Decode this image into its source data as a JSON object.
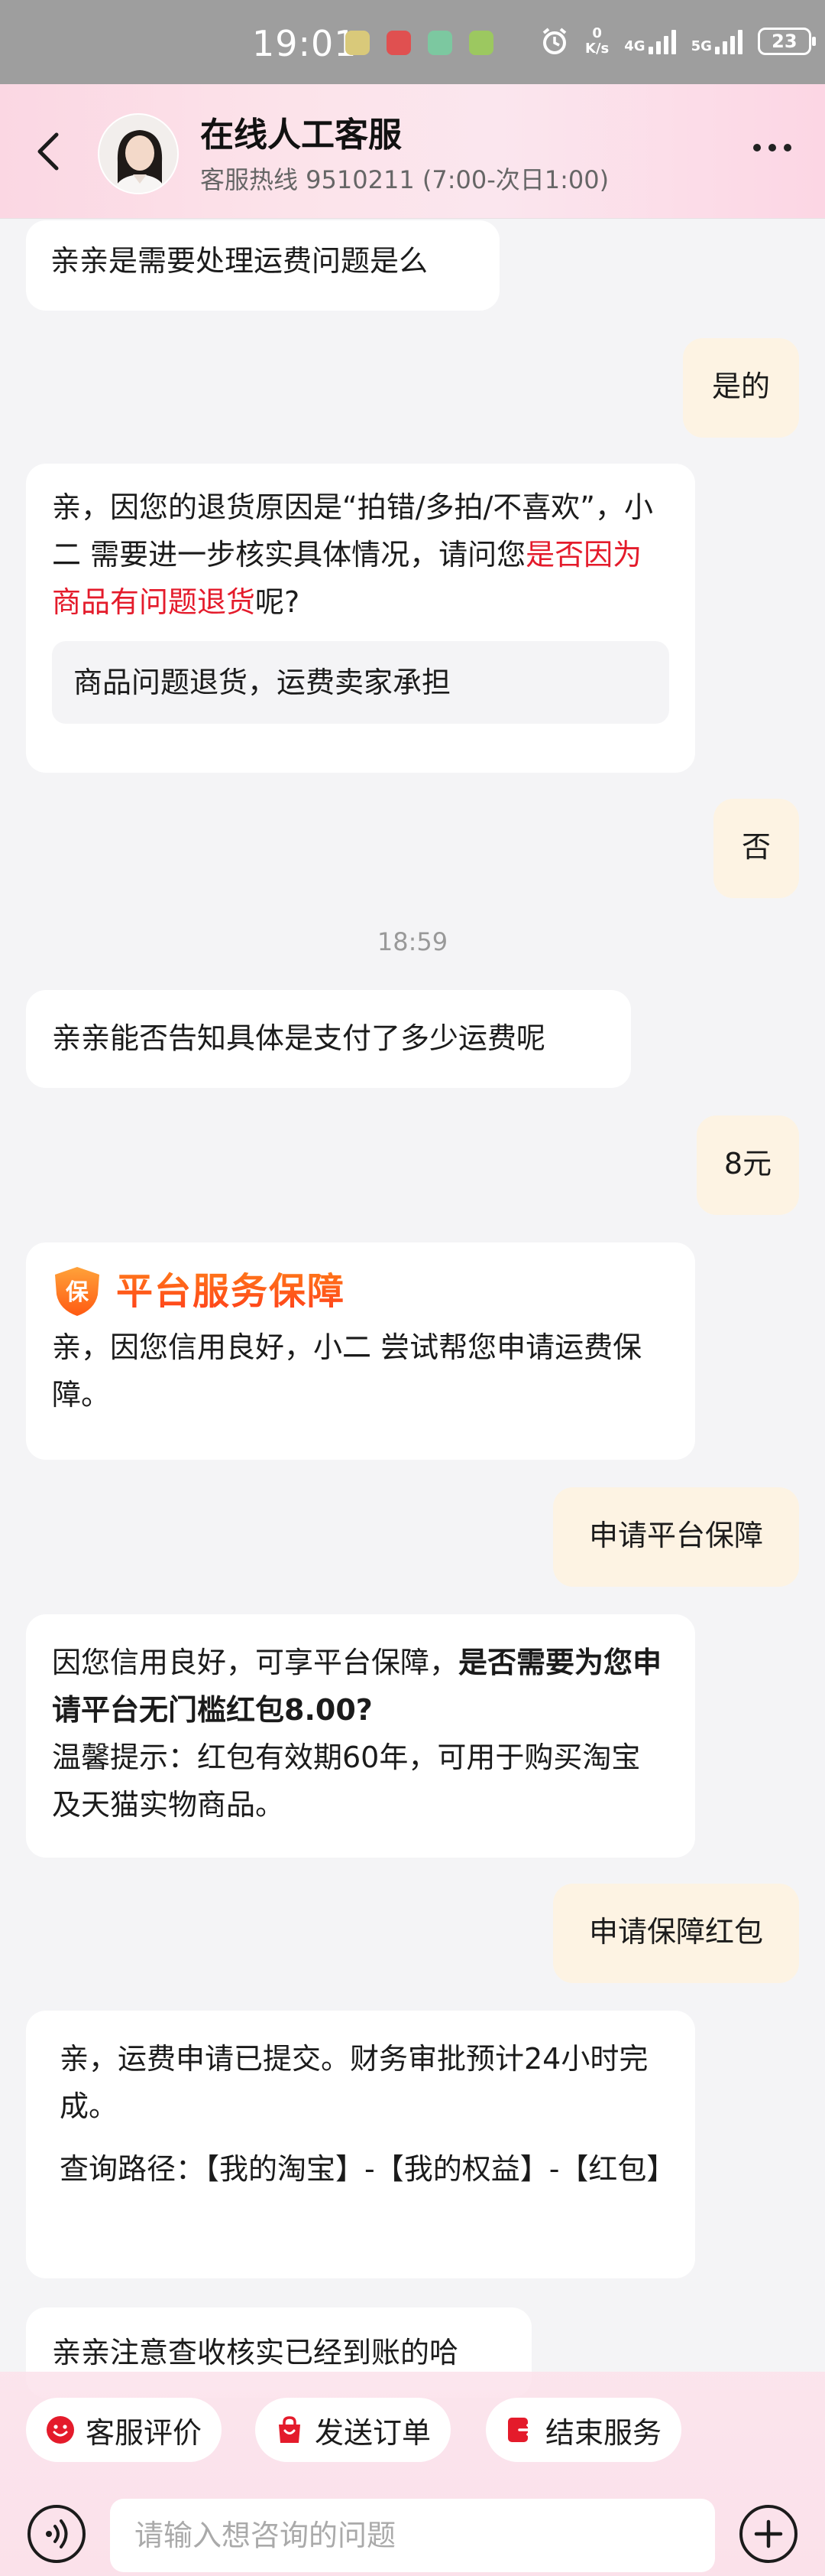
{
  "status_bar": {
    "time": "19:01",
    "network_speed_value": "0",
    "network_speed_unit": "K/s",
    "net1": "4G",
    "net2": "5G",
    "battery": "23"
  },
  "header": {
    "title": "在线人工客服",
    "subtitle": "客服热线 9510211 (7:00-次日1:00)"
  },
  "messages": {
    "m1": "亲亲是需要处理运费问题是么",
    "m2": "是的",
    "m3_a": "亲，因您的退货原因是“拍错/多拍/不喜欢”，小二 需要进一步核实具体情况，请问您",
    "m3_red": "是否因为商品有问题退货",
    "m3_b": "呢?",
    "m3_option": "商品问题退货，运费卖家承担",
    "m4": "否",
    "time_divider": "18:59",
    "m5": "亲亲能否告知具体是支付了多少运费呢",
    "m6": "8元",
    "m7_title": "平台服务保障",
    "m7_badge": "保",
    "m7_text": "亲，因您信用良好，小二 尝试帮您申请运费保障。",
    "m8": "申请平台保障",
    "m9_a": "因您信用良好，可享平台保障，",
    "m9_bold": "是否需要为您申请平台无门槛红包8.00?",
    "m9_b": "温馨提示：红包有效期60年，可用于购买淘宝及天猫实物商品。",
    "m10": "申请保障红包",
    "m11_a": "亲，运费申请已提交。财务审批预计24小时完成。",
    "m11_b": "查询路径：【我的淘宝】-【我的权益】-【红包】",
    "m12": "亲亲注意查收核实已经到账的哈"
  },
  "quick_actions": {
    "rate": "客服评价",
    "send_order": "发送订单",
    "end_service": "结束服务"
  },
  "input": {
    "placeholder": "请输入想咨询的问题"
  },
  "colors": {
    "accent_red": "#e41b2b",
    "user_bubble": "#fdf3e3",
    "header_pink": "#fbd7e3",
    "guarantee_orange": "#ff6a1a"
  }
}
